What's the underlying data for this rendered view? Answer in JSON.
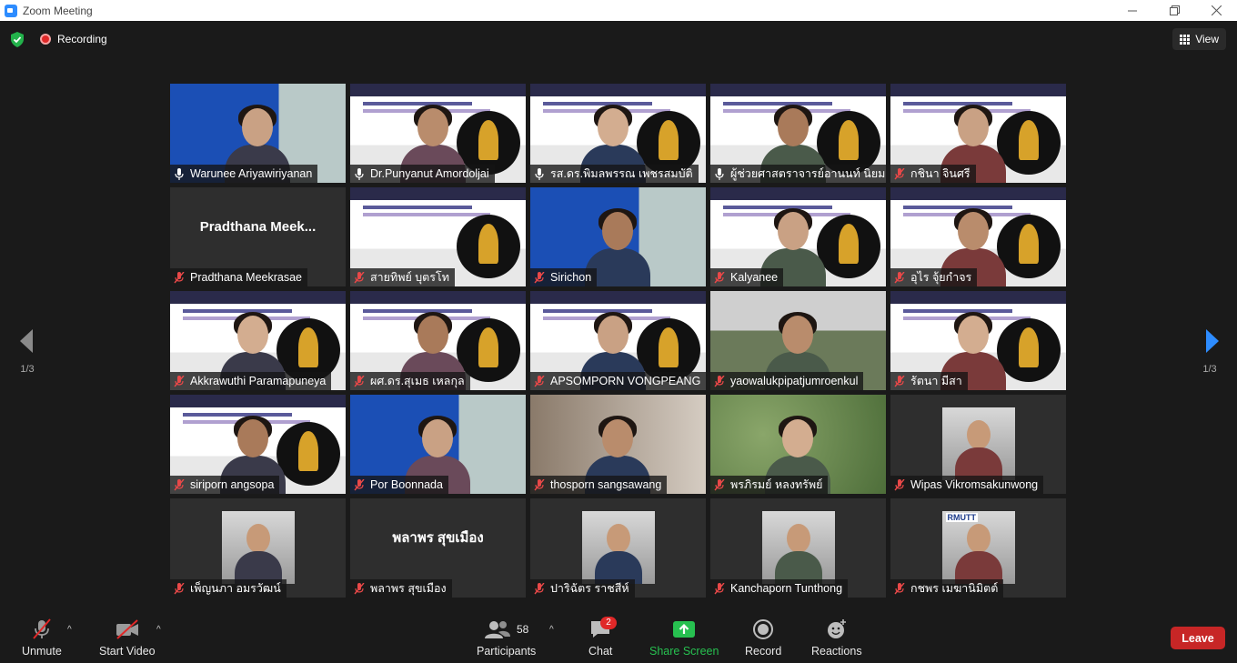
{
  "window": {
    "title": "Zoom Meeting"
  },
  "topbar": {
    "recording_label": "Recording",
    "view_label": "View"
  },
  "pagination": {
    "left_page": "1/3",
    "right_page": "1/3"
  },
  "participants": [
    {
      "name": "Warunee Ariyawiriyanan",
      "bg": "blue",
      "mic": "on"
    },
    {
      "name": "Dr.Punyanut Amordoljai",
      "bg": "white",
      "mic": "on",
      "speaking": true
    },
    {
      "name": "รส.ดร.พิมลพรรณ เพชรสมบัติ",
      "bg": "white",
      "mic": "on"
    },
    {
      "name": "ผู้ช่วยศาสตราจารย์อานนท์ นิยม...",
      "bg": "white",
      "mic": "on"
    },
    {
      "name": "กชินา จินศรี",
      "bg": "white",
      "mic": "off"
    },
    {
      "name": "Pradthana Meekrasae",
      "bg": "dark",
      "mic": "off",
      "display_text": "Pradthana Meek..."
    },
    {
      "name": "สายทิพย์ บุตรโท",
      "bg": "white",
      "mic": "off",
      "no_person": true
    },
    {
      "name": "Sirichon",
      "bg": "blue",
      "mic": "off"
    },
    {
      "name": "Kalyanee",
      "bg": "white",
      "mic": "off"
    },
    {
      "name": "อุไร จุ้ยกำจร",
      "bg": "white",
      "mic": "off"
    },
    {
      "name": "Akkrawuthi Paramapuneya",
      "bg": "white",
      "mic": "off"
    },
    {
      "name": "ผศ.ดร.สุเมธ เหลกุล",
      "bg": "white",
      "mic": "off"
    },
    {
      "name": "APSOMPORN VONGPEANG",
      "bg": "white",
      "mic": "off"
    },
    {
      "name": "yaowalukpipatjumroenkul",
      "bg": "campus",
      "mic": "off"
    },
    {
      "name": "รัตนา มีสา",
      "bg": "white",
      "mic": "off"
    },
    {
      "name": "siriporn angsopa",
      "bg": "white",
      "mic": "off"
    },
    {
      "name": "Por Boonnada",
      "bg": "blue",
      "mic": "off"
    },
    {
      "name": "thosporn sangsawang",
      "bg": "room",
      "mic": "off"
    },
    {
      "name": "พรภิรมย์ หลงทรัพย์",
      "bg": "green",
      "mic": "off"
    },
    {
      "name": "Wipas Vikromsakunwong",
      "bg": "photo",
      "mic": "off"
    },
    {
      "name": "เพ็ญนภา อมรวัฒน์",
      "bg": "photo",
      "mic": "off"
    },
    {
      "name": "พลาพร สุขเมือง",
      "bg": "dark",
      "mic": "off",
      "display_text": "พลาพร สุขเมือง"
    },
    {
      "name": "ปาริฉัตร ราชสีห์",
      "bg": "photo",
      "mic": "off"
    },
    {
      "name": "Kanchaporn Tunthong",
      "bg": "photo",
      "mic": "off"
    },
    {
      "name": "กชพร เมฆานิมิตต์",
      "bg": "photo",
      "mic": "off",
      "photo_text": "RMUTT"
    }
  ],
  "toolbar": {
    "unmute_label": "Unmute",
    "video_label": "Start Video",
    "participants_label": "Participants",
    "participants_count": "58",
    "chat_label": "Chat",
    "chat_badge": "2",
    "share_label": "Share Screen",
    "record_label": "Record",
    "reactions_label": "Reactions",
    "leave_label": "Leave"
  },
  "colors": {
    "accent_blue": "#2d8cff",
    "share_green": "#27c050",
    "leave_red": "#c72626",
    "speaking_border": "#e9e07a"
  }
}
